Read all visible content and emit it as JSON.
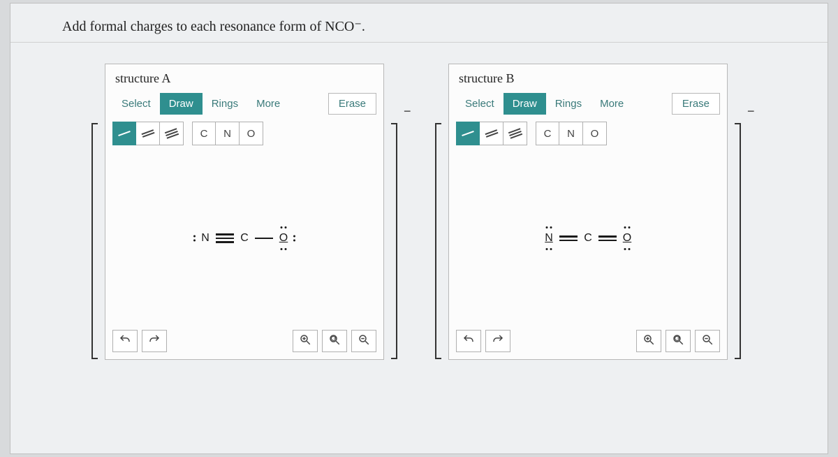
{
  "prompt": "Add formal charges to each resonance form of NCO⁻.",
  "charge_symbol": "−",
  "structures": [
    {
      "title": "structure A",
      "tabs": {
        "select": "Select",
        "draw": "Draw",
        "rings": "Rings",
        "more": "More",
        "active": "draw"
      },
      "erase": "Erase",
      "bond_active_index": 0,
      "elements": [
        "C",
        "N",
        "O"
      ],
      "molecule": {
        "atoms": [
          {
            "label": "N",
            "lone_pairs": [
              "left"
            ],
            "underline": false
          },
          {
            "label": "C",
            "lone_pairs": [],
            "underline": false
          },
          {
            "label": "O",
            "lone_pairs": [
              "top",
              "right",
              "bottom"
            ],
            "underline": true
          }
        ],
        "bonds": [
          3,
          1
        ]
      }
    },
    {
      "title": "structure B",
      "tabs": {
        "select": "Select",
        "draw": "Draw",
        "rings": "Rings",
        "more": "More",
        "active": "draw"
      },
      "erase": "Erase",
      "bond_active_index": 0,
      "elements": [
        "C",
        "N",
        "O"
      ],
      "molecule": {
        "atoms": [
          {
            "label": "N",
            "lone_pairs": [
              "top",
              "bottom"
            ],
            "underline": true
          },
          {
            "label": "C",
            "lone_pairs": [],
            "underline": false
          },
          {
            "label": "O",
            "lone_pairs": [
              "top",
              "bottom"
            ],
            "underline": true
          }
        ],
        "bonds": [
          2,
          2
        ]
      }
    }
  ],
  "icons": {
    "undo": "undo-icon",
    "redo": "redo-icon",
    "zoom_in": "zoom-in-icon",
    "reset_zoom": "reset-zoom-icon",
    "zoom_out": "zoom-out-icon"
  }
}
